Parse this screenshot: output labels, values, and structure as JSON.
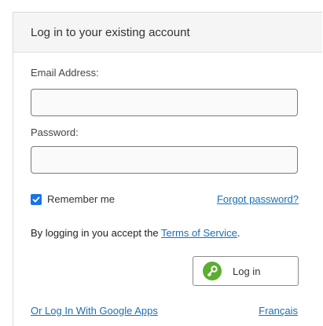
{
  "header": {
    "title": "Log in to your existing account"
  },
  "form": {
    "email_label": "Email Address:",
    "email_value": "",
    "password_label": "Password:",
    "password_value": "",
    "remember_label": "Remember me",
    "remember_checked": true,
    "forgot_label": "Forgot password?",
    "terms_prefix": "By logging in you accept the ",
    "terms_link": "Terms of Service",
    "terms_suffix": ".",
    "login_label": "Log in"
  },
  "footer": {
    "google_link": "Or Log In With Google Apps",
    "language_link": "Français"
  },
  "colors": {
    "accent_link": "#1a6fb5",
    "checkbox": "#1a73e8",
    "key_icon_bg": "#5dad2f",
    "header_bg": "#f5f5f5"
  },
  "icons": {
    "checkbox": "check-icon",
    "login": "key-icon"
  }
}
